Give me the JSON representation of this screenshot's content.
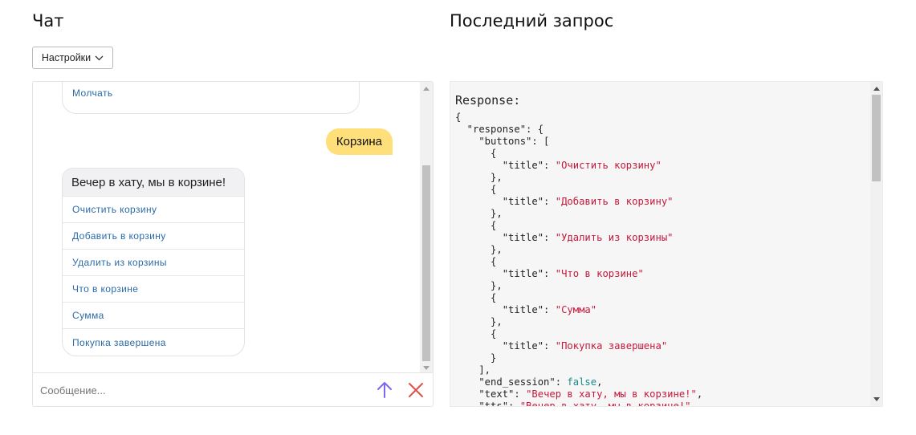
{
  "headers": {
    "chat": "Чат",
    "request": "Последний запрос"
  },
  "settings": {
    "label": "Настройки"
  },
  "chat": {
    "previous_button": "Молчать",
    "user_message": "Корзина",
    "bot_message": "Вечер в хату, мы в корзине!",
    "bot_buttons": [
      "Очистить корзину",
      "Добавить в корзину",
      "Удалить из корзины",
      "Что в корзине",
      "Сумма",
      "Покупка завершена"
    ],
    "input_placeholder": "Сообщение...",
    "accent_send": "#7b68ee",
    "accent_clear": "#e0504a"
  },
  "request": {
    "label": "Response:",
    "lines": [
      [
        [
          "p",
          "{"
        ]
      ],
      [
        [
          "p",
          "  \"response\": {"
        ]
      ],
      [
        [
          "p",
          "    \"buttons\": ["
        ]
      ],
      [
        [
          "p",
          "      {"
        ]
      ],
      [
        [
          "p",
          "        \"title\": "
        ],
        [
          "s",
          "\"Очистить корзину\""
        ]
      ],
      [
        [
          "p",
          "      },"
        ]
      ],
      [
        [
          "p",
          "      {"
        ]
      ],
      [
        [
          "p",
          "        \"title\": "
        ],
        [
          "s",
          "\"Добавить в корзину\""
        ]
      ],
      [
        [
          "p",
          "      },"
        ]
      ],
      [
        [
          "p",
          "      {"
        ]
      ],
      [
        [
          "p",
          "        \"title\": "
        ],
        [
          "s",
          "\"Удалить из корзины\""
        ]
      ],
      [
        [
          "p",
          "      },"
        ]
      ],
      [
        [
          "p",
          "      {"
        ]
      ],
      [
        [
          "p",
          "        \"title\": "
        ],
        [
          "s",
          "\"Что в корзине\""
        ]
      ],
      [
        [
          "p",
          "      },"
        ]
      ],
      [
        [
          "p",
          "      {"
        ]
      ],
      [
        [
          "p",
          "        \"title\": "
        ],
        [
          "s",
          "\"Сумма\""
        ]
      ],
      [
        [
          "p",
          "      },"
        ]
      ],
      [
        [
          "p",
          "      {"
        ]
      ],
      [
        [
          "p",
          "        \"title\": "
        ],
        [
          "s",
          "\"Покупка завершена\""
        ]
      ],
      [
        [
          "p",
          "      }"
        ]
      ],
      [
        [
          "p",
          "    ],"
        ]
      ],
      [
        [
          "p",
          "    \"end_session\": "
        ],
        [
          "l",
          "false"
        ],
        [
          "p",
          ","
        ]
      ],
      [
        [
          "p",
          "    \"text\": "
        ],
        [
          "s",
          "\"Вечер в хату, мы в корзине!\""
        ],
        [
          "p",
          ","
        ]
      ],
      [
        [
          "p",
          "    \"tts\": "
        ],
        [
          "s",
          "\"Вечер в хату, мы в корзине!\""
        ]
      ]
    ]
  }
}
